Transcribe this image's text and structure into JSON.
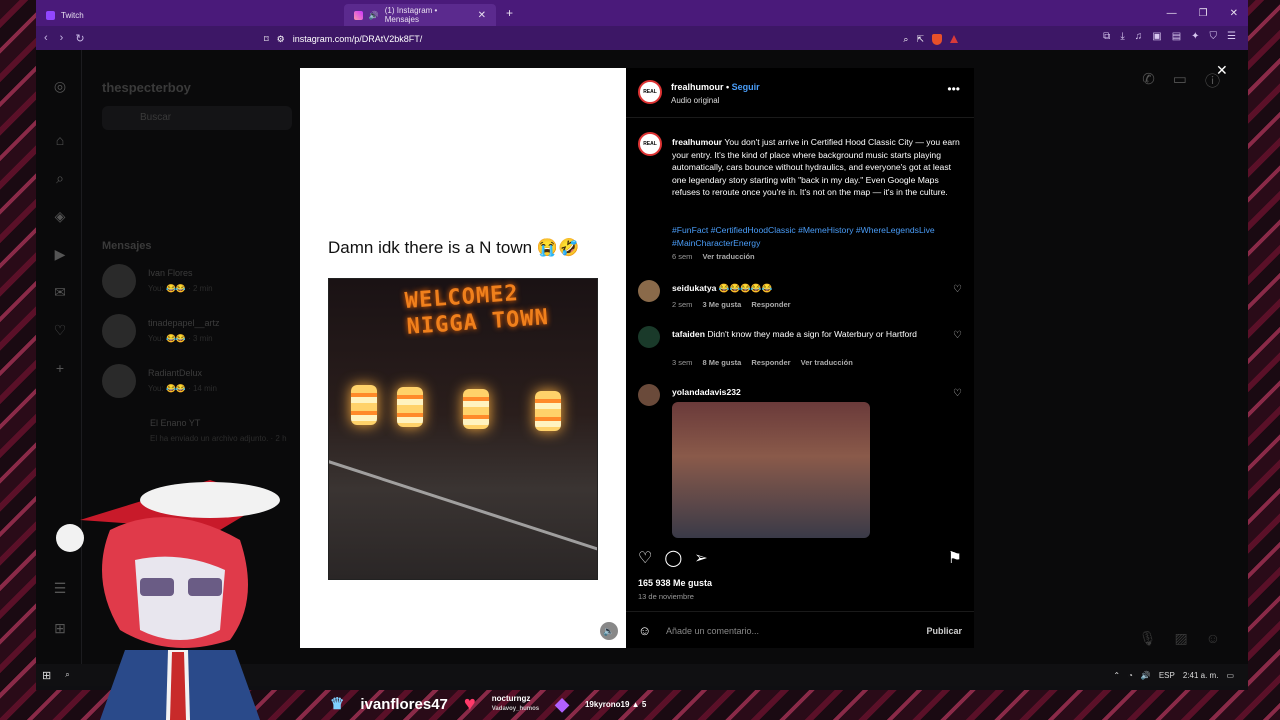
{
  "browser": {
    "tabs": [
      {
        "label": "Twitch",
        "active": false
      },
      {
        "label": "(1) Instagram • Mensajes",
        "active": true
      }
    ],
    "url": "instagram.com/p/DRAtV2bk8FT/"
  },
  "instagram": {
    "dm_username": "thespecterboy",
    "search_placeholder": "Buscar",
    "messages_title": "Mensajes",
    "dm_threads": [
      {
        "name": "Ivan Flores",
        "preview": "You: 😂😂 · 2 min"
      },
      {
        "name": "tinadepapel__artz",
        "preview": "You: 😂😂 · 3 min"
      },
      {
        "name": "RadiantDelux",
        "preview": "You: 😂😂 · 14 min"
      },
      {
        "name": "El Enano YT",
        "preview": "El ha enviado un archivo adjunto. · 2 h"
      }
    ]
  },
  "post": {
    "media_caption": "Damn idk there is a N town 😭🤣",
    "sign_text": "WELCOME2 NIGGA TOWN",
    "author": "frealhumour",
    "follow_label": "Seguir",
    "audio": "Audio original",
    "avatar_text": "REAL",
    "caption": "You don't just arrive in Certified Hood Classic City — you earn your entry. It's the kind of place where background music starts playing automatically, cars bounce without hydraulics, and everyone's got at least one legendary story starting with \"back in my day.\" Even Google Maps refuses to reroute once you're in. It's not on the map — it's in the culture.",
    "hashtags": "#FunFact #CertifiedHoodClassic #MemeHistory #WhereLegendsLive #MainCharacterEnergy",
    "caption_time": "6 sem",
    "caption_translate": "Ver traducción",
    "comments": [
      {
        "user": "seidukatya",
        "text": "😂😂😂😂😂",
        "time": "2 sem",
        "likes": "3 Me gusta",
        "reply": "Responder",
        "translate": ""
      },
      {
        "user": "tafaiden",
        "text": "Didn't know they made a sign for Waterbury or Hartford",
        "time": "3 sem",
        "likes": "8 Me gusta",
        "reply": "Responder",
        "translate": "Ver traducción"
      },
      {
        "user": "yolandadavis232",
        "text": "",
        "time": "",
        "likes": "",
        "reply": "",
        "translate": ""
      }
    ],
    "likes": "165 938 Me gusta",
    "date": "13 de noviembre",
    "comment_placeholder": "Añade un comentario...",
    "publish_label": "Publicar"
  },
  "taskbar": {
    "lang": "ESP",
    "time": "2:41 a. m."
  },
  "overlay": {
    "sub_name": "ivanflores47",
    "donor_name": "nocturngz",
    "donor_sub": "Vadavoy_humos",
    "bits_user": "19kyrono19",
    "bits_count": "5"
  },
  "colors": {
    "tabbar": "#4a1a7a",
    "addressbar": "#3d1766",
    "link_blue": "#4a9df8",
    "sign_orange": "#f0801c"
  }
}
